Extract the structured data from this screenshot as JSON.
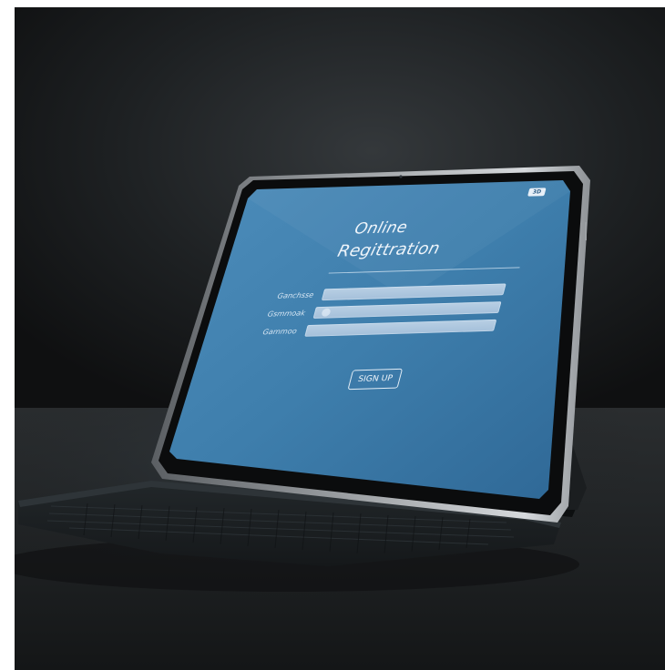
{
  "scene": {
    "subject": "tablet-with-keyboard"
  },
  "screen": {
    "title_line1": "Online",
    "title_line2": "Regittration",
    "fields": [
      {
        "label": "Ganchsse"
      },
      {
        "label": "Gsmmoak"
      },
      {
        "label": "Gammoo"
      }
    ],
    "button_label": "SIGN UP",
    "badge": "3D"
  },
  "colors": {
    "background_dark": "#151617",
    "screen_blue": "#3f7fad",
    "screen_blue_light": "#5a97c2",
    "bezel": "#0b0c0d",
    "frame_silver": "#b9bcc0",
    "keyboard": "#1d2124"
  }
}
